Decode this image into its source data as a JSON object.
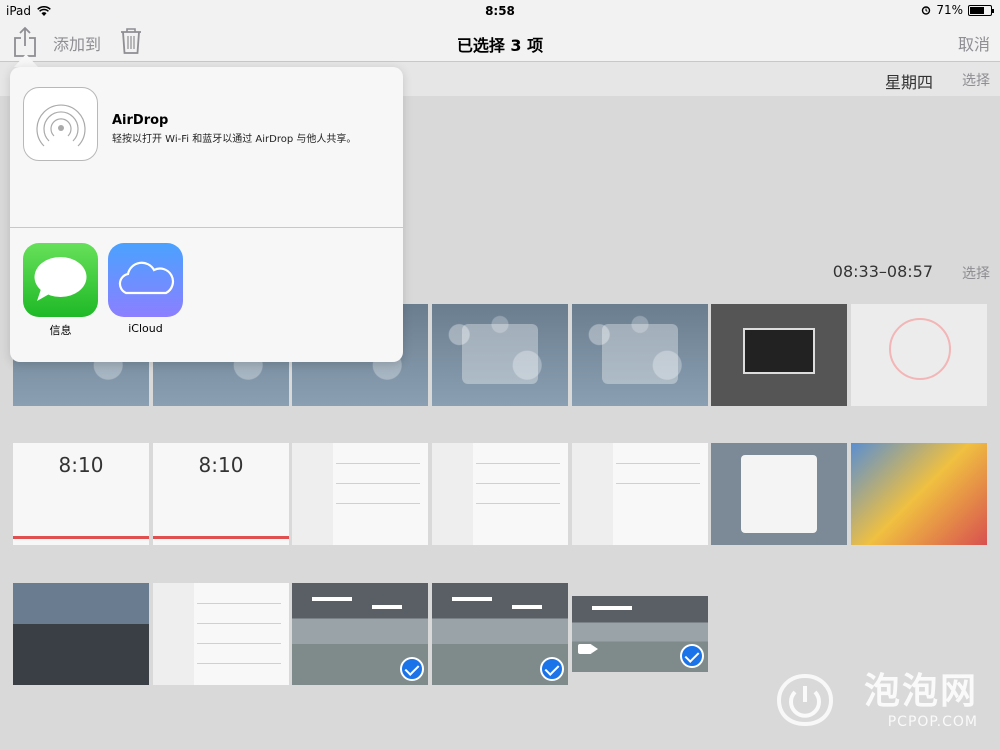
{
  "statusbar": {
    "device": "iPad",
    "time": "8:58",
    "battery": "71%",
    "battery_level": 0.71
  },
  "navbar": {
    "add_to": "添加到",
    "title": "已选择 3 项",
    "cancel": "取消"
  },
  "sections": [
    {
      "date": "星期四",
      "select": "选择"
    },
    {
      "date": "08:33–08:57",
      "select": "选择"
    }
  ],
  "share_popover": {
    "airdrop_title": "AirDrop",
    "airdrop_desc": "轻按以打开 Wi-Fi 和蓝牙以通过 AirDrop 与他人共享。",
    "apps": [
      {
        "label": "信息",
        "icon": "messages-icon"
      },
      {
        "label": "iCloud",
        "icon": "icloud-icon"
      }
    ]
  },
  "thumbnails": {
    "row1": [
      "home-screen",
      "home-screen",
      "lock-screen",
      "folder",
      "folder",
      "dark-window",
      "compass"
    ],
    "row2": [
      "clock",
      "clock",
      "settings",
      "settings",
      "settings",
      "alert",
      "share-sheet"
    ],
    "row3": [
      "keyboard",
      "settings",
      "office-photo",
      "office-photo",
      "office-video"
    ],
    "clock_time": "8:10",
    "selected": [
      "row3.2",
      "row3.3",
      "row3.4"
    ]
  },
  "watermark": {
    "main": "泡泡网",
    "sub": "PCPOP.COM"
  }
}
